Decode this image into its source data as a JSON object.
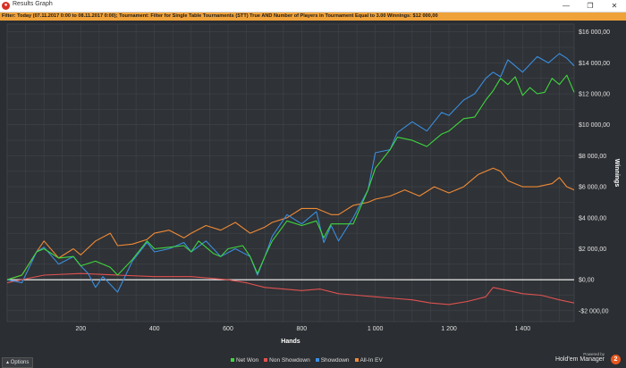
{
  "window": {
    "title": "Results Graph",
    "minimize_glyph": "—",
    "maximize_glyph": "❐",
    "close_glyph": "✕",
    "app_icon": "record-icon"
  },
  "filter": {
    "text": "Filter: Today (07.11.2017 0:00 to 08.11.2017 0:00); Tournament: Filter for Single Table Tournaments (STT) True AND Number of Players in Tournament Equal to 3.00  Winnings: $12 000,00"
  },
  "chart_data": {
    "type": "line",
    "xlabel": "Hands",
    "ylabel": "Winnings",
    "xlim": [
      0,
      1540
    ],
    "ylim": [
      -2700,
      16500
    ],
    "x_ticks": [
      200,
      400,
      600,
      800,
      1000,
      1200,
      1400
    ],
    "x_tick_labels": [
      "200",
      "400",
      "600",
      "800",
      "1 000",
      "1 200",
      "1 400"
    ],
    "y_ticks": [
      -2000,
      0,
      2000,
      4000,
      6000,
      8000,
      10000,
      12000,
      14000,
      16000
    ],
    "y_tick_labels": [
      "-$2 000,00",
      "$0,00",
      "$2 000,00",
      "$4 000,00",
      "$6 000,00",
      "$8 000,00",
      "$10 000,00",
      "$12 000,00",
      "$14 000,00",
      "$16 000,00"
    ],
    "grid": true,
    "legend_position": "bottom",
    "series": [
      {
        "name": "Net Won",
        "color": "#3ed63e",
        "x": [
          0,
          40,
          80,
          100,
          140,
          180,
          200,
          240,
          280,
          300,
          340,
          380,
          400,
          440,
          480,
          500,
          520,
          560,
          580,
          600,
          640,
          660,
          680,
          700,
          720,
          760,
          800,
          840,
          860,
          880,
          900,
          940,
          980,
          1000,
          1040,
          1060,
          1100,
          1140,
          1180,
          1200,
          1240,
          1270,
          1300,
          1320,
          1340,
          1360,
          1380,
          1400,
          1420,
          1440,
          1460,
          1480,
          1500,
          1520,
          1540
        ],
        "y": [
          0,
          300,
          1800,
          2000,
          1400,
          1500,
          900,
          1200,
          800,
          300,
          1300,
          2500,
          2000,
          2100,
          2200,
          1800,
          2500,
          1700,
          1500,
          2000,
          2200,
          1500,
          400,
          1500,
          2500,
          3800,
          3500,
          3800,
          2700,
          3600,
          3600,
          3600,
          5800,
          7200,
          8400,
          9200,
          9000,
          8600,
          9400,
          9600,
          10400,
          10500,
          11600,
          12200,
          13000,
          12600,
          13100,
          11900,
          12400,
          12000,
          12100,
          13000,
          12600,
          13200,
          12100
        ]
      },
      {
        "name": "Non Showdown",
        "color": "#e05252",
        "x": [
          0,
          100,
          200,
          300,
          400,
          500,
          550,
          600,
          650,
          700,
          750,
          800,
          850,
          900,
          950,
          1000,
          1050,
          1100,
          1150,
          1200,
          1250,
          1300,
          1320,
          1360,
          1400,
          1450,
          1500,
          1540
        ],
        "y": [
          -200,
          300,
          400,
          300,
          200,
          200,
          100,
          0,
          -200,
          -500,
          -600,
          -700,
          -600,
          -900,
          -1000,
          -1100,
          -1200,
          -1300,
          -1500,
          -1600,
          -1400,
          -1100,
          -500,
          -700,
          -900,
          -1000,
          -1300,
          -1500
        ]
      },
      {
        "name": "Showdown",
        "color": "#3a8ee0",
        "x": [
          0,
          40,
          80,
          100,
          140,
          180,
          200,
          220,
          240,
          260,
          280,
          300,
          340,
          380,
          400,
          440,
          480,
          500,
          540,
          580,
          620,
          660,
          680,
          700,
          720,
          760,
          800,
          840,
          860,
          880,
          900,
          940,
          980,
          1000,
          1040,
          1060,
          1100,
          1140,
          1180,
          1200,
          1240,
          1270,
          1300,
          1320,
          1340,
          1360,
          1400,
          1440,
          1470,
          1500,
          1520,
          1540
        ],
        "y": [
          0,
          -200,
          1800,
          2100,
          1000,
          1500,
          900,
          400,
          -500,
          200,
          -300,
          -800,
          1200,
          2400,
          1800,
          2000,
          2400,
          1800,
          2500,
          1500,
          2000,
          1500,
          300,
          1500,
          2800,
          4200,
          3600,
          4400,
          2400,
          3500,
          2500,
          4000,
          5800,
          8200,
          8400,
          9500,
          10200,
          9600,
          10800,
          10600,
          11600,
          12000,
          13000,
          13400,
          13100,
          14200,
          13400,
          14400,
          14000,
          14600,
          14300,
          13800
        ]
      },
      {
        "name": "All-In EV",
        "color": "#f08a36",
        "x": [
          0,
          40,
          80,
          100,
          140,
          180,
          200,
          240,
          280,
          300,
          340,
          380,
          400,
          440,
          480,
          500,
          540,
          580,
          620,
          660,
          700,
          720,
          760,
          800,
          840,
          880,
          900,
          940,
          980,
          1000,
          1040,
          1080,
          1120,
          1160,
          1200,
          1240,
          1280,
          1320,
          1340,
          1360,
          1400,
          1440,
          1480,
          1500,
          1520,
          1540
        ],
        "y": [
          0,
          300,
          1800,
          2500,
          1400,
          2000,
          1600,
          2500,
          3000,
          2200,
          2300,
          2600,
          3000,
          3200,
          2700,
          3000,
          3500,
          3200,
          3700,
          3000,
          3400,
          3700,
          4000,
          4600,
          4600,
          4200,
          4200,
          4800,
          5000,
          5200,
          5400,
          5800,
          5400,
          6000,
          5600,
          6000,
          6800,
          7200,
          7000,
          6400,
          6000,
          6000,
          6200,
          6600,
          6000,
          5800
        ]
      }
    ]
  },
  "footer": {
    "options_label": "Options",
    "options_glyph": "▴",
    "powered_by": "Powered by",
    "brand": "Hold'em Manager",
    "brand_badge": "2"
  }
}
